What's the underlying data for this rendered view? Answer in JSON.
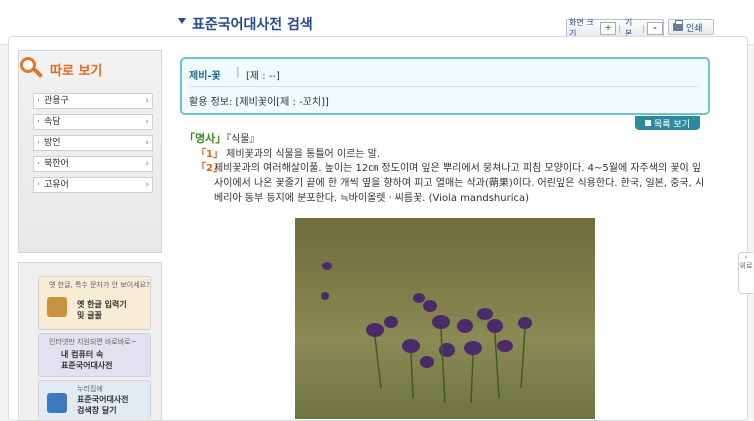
{
  "header": {
    "title": "표준국어대사전 검색",
    "zoom_label": "화면 크기",
    "zoom_in": "+",
    "zoom_default": "기본",
    "zoom_out": "-",
    "print_label": "인쇄"
  },
  "sidebar": {
    "title": "따로 보기",
    "items": [
      {
        "label": "관용구"
      },
      {
        "label": "속담"
      },
      {
        "label": "방언"
      },
      {
        "label": "북한어"
      },
      {
        "label": "고유어"
      }
    ]
  },
  "promos": [
    {
      "sub": "옛 한글, 특수 문자가 안 보이세요?",
      "main1": "옛 한글 입력기",
      "main2": "및 글꼴"
    },
    {
      "sub": "인터넷만 지원되면 바로바로~",
      "main1": "내 컴퓨터 속",
      "main2": "표준국어대사전"
    },
    {
      "sub": "누리집에",
      "main1": "표준국어대사전",
      "main2": "검색창 달기"
    }
  ],
  "entry": {
    "headword": "제비-꽃",
    "headword_note": "[제 : --]",
    "usage": "활용 정보:  [제비꽃이[제 : -꼬치]]",
    "toc_button": "목록 보기",
    "pos": "「명사」",
    "category": "『식물』",
    "senses": [
      {
        "num": "「1」",
        "text": "제비꽃과의 식물을 통틀어 이르는 말."
      },
      {
        "num": "「2」",
        "text": "제비꽃과의 여러해살이풀. 높이는 12㎝ 정도이며 잎은 뿌리에서 뭉쳐나고 피침 모양이다. 4~5월에 자주색의 꽃이 잎 사이에서 나온 꽃줄기 끝에 한 개씩 옆을 향하여 피고 열매는 삭과(蒴果)이다. 어린잎은 식용한다. 한국, 일본, 중국, 시베리아 동부 등지에 분포한다. ≒바이올렛ㆍ씨름꽃. (Viola mandshurica)"
      }
    ]
  },
  "side_tab": "위로",
  "colors": {
    "accent": "#2b4a8a",
    "orange": "#e0641a",
    "teal": "#2f8aa0",
    "green": "#3a8a24"
  }
}
